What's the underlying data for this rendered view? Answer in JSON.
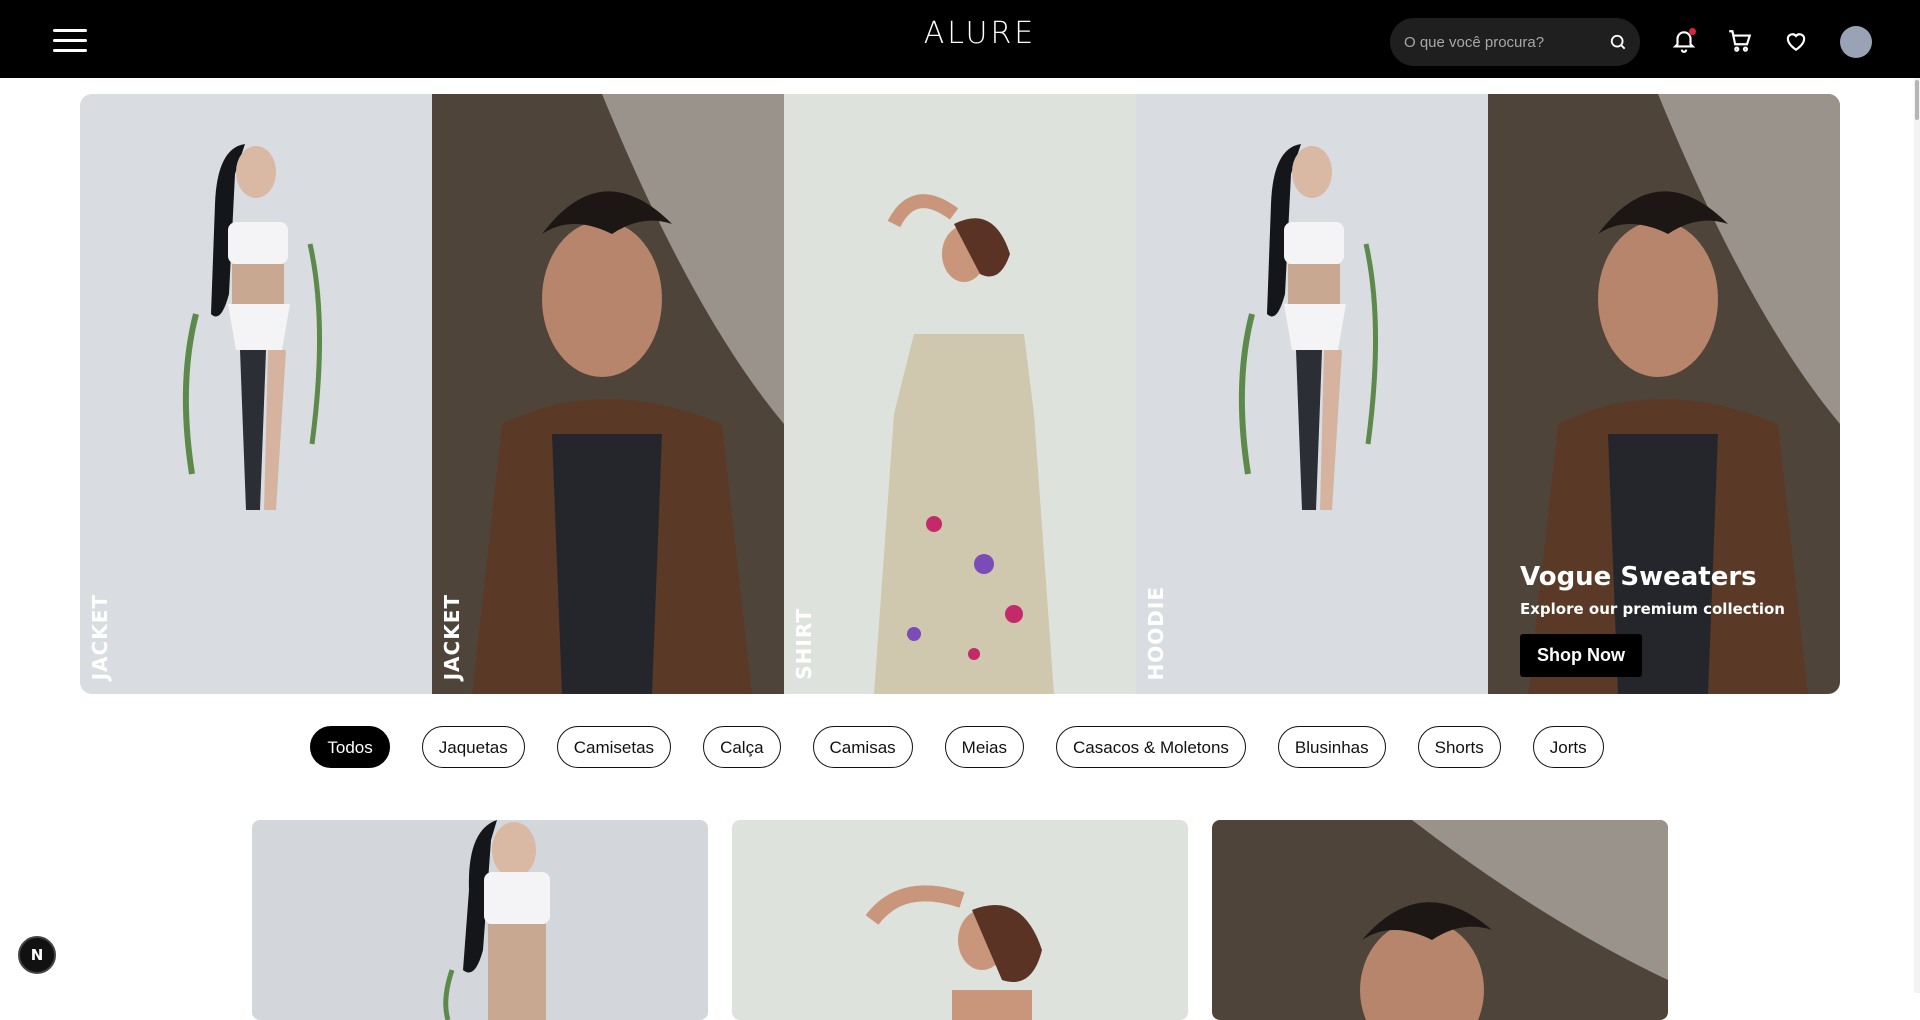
{
  "header": {
    "brand": "ALURE",
    "search_placeholder": "O que você procura?",
    "icons": [
      "menu-icon",
      "search-icon",
      "bell-icon",
      "cart-icon",
      "heart-icon",
      "avatar"
    ]
  },
  "hero": {
    "panels": [
      {
        "label": "JACKET"
      },
      {
        "label": "JACKET"
      },
      {
        "label": "SHIRT"
      },
      {
        "label": "HOODIE"
      },
      {
        "label": ""
      }
    ],
    "featured": {
      "title": "Vogue Sweaters",
      "subtitle": "Explore our premium collection",
      "button": "Shop Now"
    }
  },
  "filters": {
    "active": "Todos",
    "items": [
      "Todos",
      "Jaquetas",
      "Camisetas",
      "Calça",
      "Camisas",
      "Meias",
      "Casacos & Moletons",
      "Blusinhas",
      "Shorts",
      "Jorts"
    ]
  },
  "dev_badge": "N",
  "colors": {
    "header_bg": "#000000",
    "notification_dot": "#e0233a",
    "avatar": "#9aa3b6",
    "active_chip": "#000000"
  }
}
